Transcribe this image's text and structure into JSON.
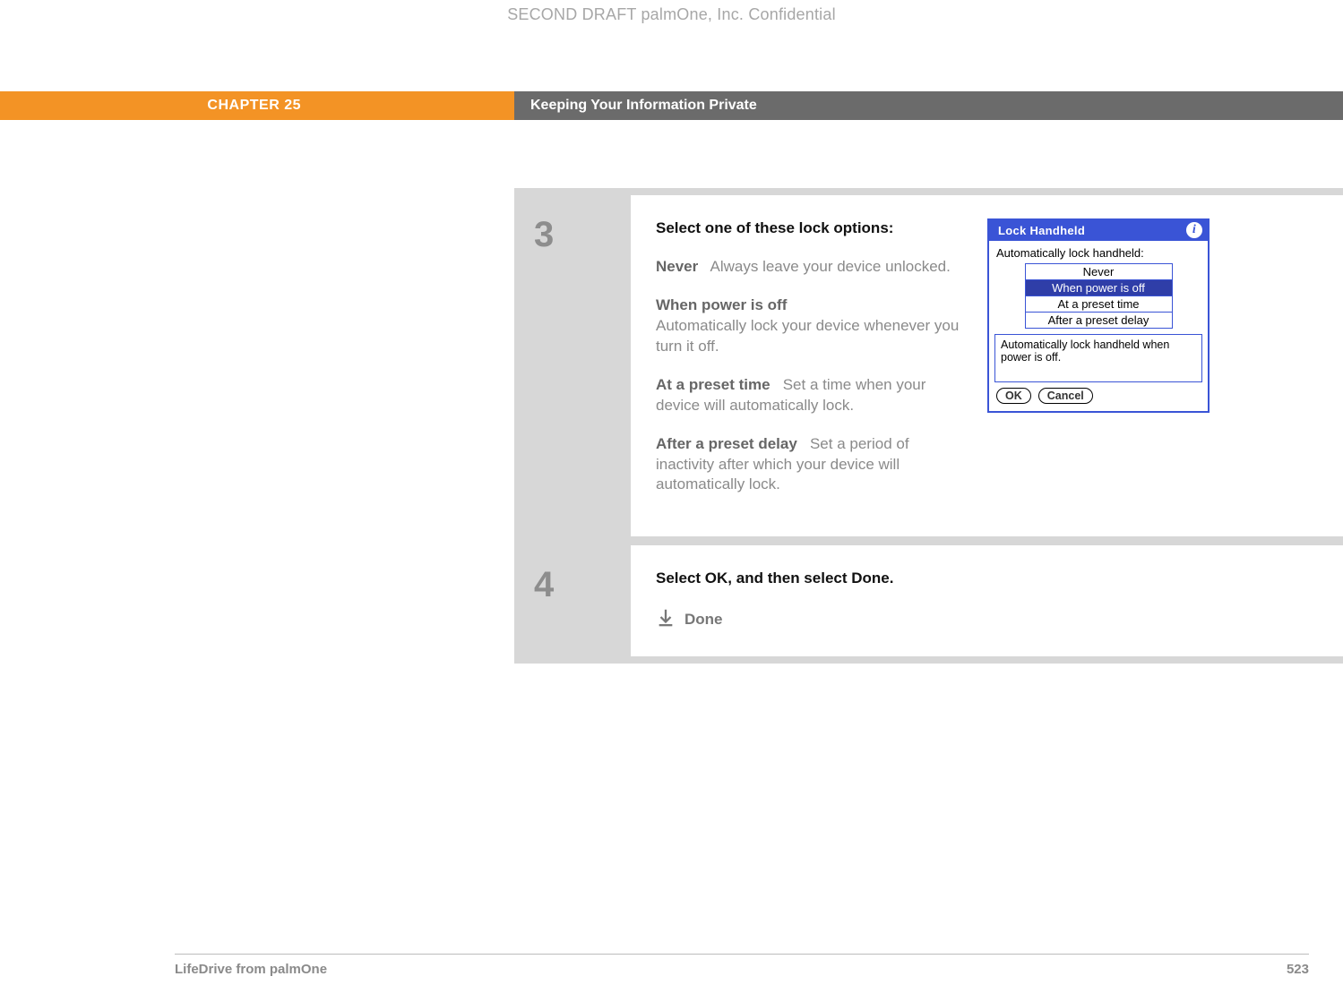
{
  "draft_header": "SECOND DRAFT palmOne, Inc.  Confidential",
  "chapter": {
    "label": "CHAPTER 25",
    "title": "Keeping Your Information Private"
  },
  "steps": {
    "s3": {
      "num": "3",
      "lead": "Select one of these lock options:",
      "opts": [
        {
          "label": "Never",
          "desc": "Always leave your device unlocked."
        },
        {
          "label": "When power is off",
          "desc": "Automatically lock your device whenever you turn it off."
        },
        {
          "label": "At a preset time",
          "desc": "Set a time when your device will automatically lock."
        },
        {
          "label": "After a preset delay",
          "desc": "Set a period of inactivity after which your device will automatically lock."
        }
      ]
    },
    "s4": {
      "num": "4",
      "lead": "Select OK, and then select Done.",
      "done_label": "Done"
    }
  },
  "lock_dialog": {
    "title": "Lock Handheld",
    "caption": "Automatically lock handheld:",
    "items": [
      "Never",
      "When power is off",
      "At a preset time",
      "After a preset delay"
    ],
    "selected_index": 1,
    "description": "Automatically lock handheld when power is off.",
    "ok": "OK",
    "cancel": "Cancel"
  },
  "footer": {
    "left": "LifeDrive from palmOne",
    "right": "523"
  }
}
